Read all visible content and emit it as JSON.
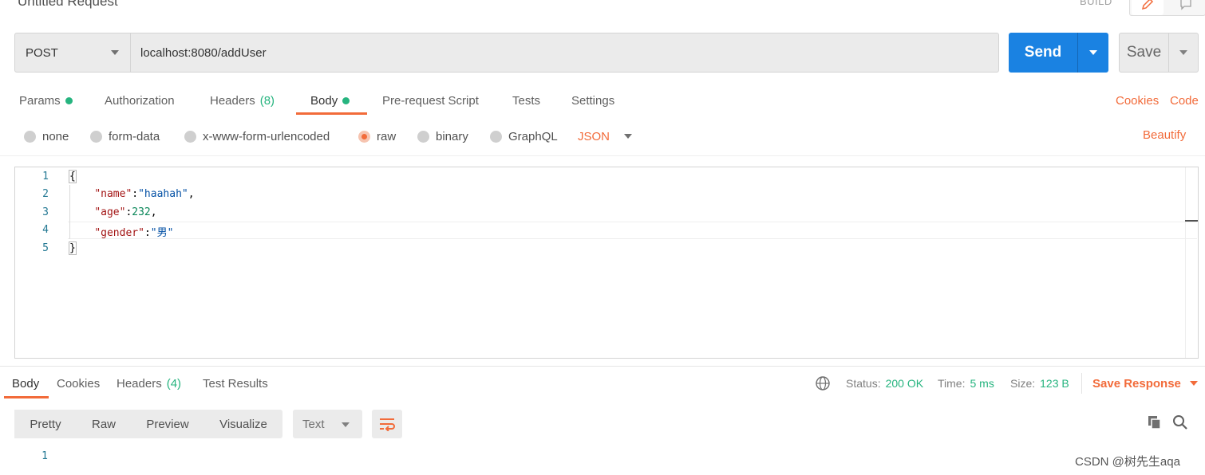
{
  "header": {
    "title": "Untitled Request",
    "build_label": "BUILD"
  },
  "request": {
    "method": "POST",
    "url": "localhost:8080/addUser",
    "send_label": "Send",
    "save_label": "Save"
  },
  "request_tabs": {
    "params": "Params",
    "authorization": "Authorization",
    "headers": "Headers",
    "headers_count": "(8)",
    "body": "Body",
    "pre_request": "Pre-request Script",
    "tests": "Tests",
    "settings": "Settings",
    "cookies": "Cookies",
    "code": "Code"
  },
  "body_types": {
    "none": "none",
    "form_data": "form-data",
    "urlencoded": "x-www-form-urlencoded",
    "raw": "raw",
    "binary": "binary",
    "graphql": "GraphQL",
    "format": "JSON",
    "beautify": "Beautify",
    "selected": "raw"
  },
  "editor": {
    "line_numbers": [
      "1",
      "2",
      "3",
      "4",
      "5"
    ],
    "lines": {
      "l1": "{",
      "l2_key": "\"name\"",
      "l2_colon": ":",
      "l2_val": "\"haahah\"",
      "l2_comma": ",",
      "l3_key": "\"age\"",
      "l3_colon": ":",
      "l3_val": "232",
      "l3_comma": ",",
      "l4_key": "\"gender\"",
      "l4_colon": ":",
      "l4_val": "\"男\"",
      "l5": "}"
    }
  },
  "response": {
    "tabs": {
      "body": "Body",
      "cookies": "Cookies",
      "headers": "Headers",
      "headers_count": "(4)",
      "test_results": "Test Results"
    },
    "status_label": "Status:",
    "status_value": "200 OK",
    "time_label": "Time:",
    "time_value": "5 ms",
    "size_label": "Size:",
    "size_value": "123 B",
    "save_response": "Save Response",
    "views": {
      "pretty": "Pretty",
      "raw": "Raw",
      "preview": "Preview",
      "visualize": "Visualize"
    },
    "format": "Text",
    "line_number": "1"
  },
  "watermark": "CSDN @树先生aqa",
  "colors": {
    "accent_orange": "#f26b3a",
    "send_blue": "#1a82e2",
    "success_green": "#26b47f"
  }
}
